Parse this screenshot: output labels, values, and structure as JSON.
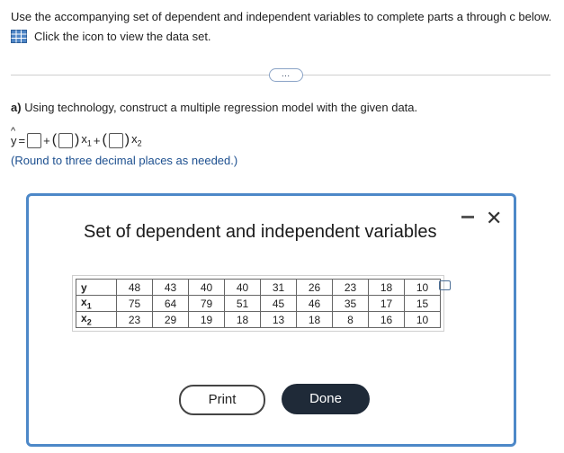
{
  "instructions": "Use the accompanying set of dependent and independent variables to complete parts a through c below.",
  "dataset_link": "Click the icon to view the data set.",
  "more_button": "…",
  "part_a": {
    "label": "a)",
    "prompt": "Using technology, construct a multiple regression model with the given data.",
    "round_note": "(Round to three decimal places as needed.)",
    "equation": {
      "lhs": "y",
      "eq": "=",
      "plus": "+",
      "x1": "x",
      "x1_sub": "1",
      "x2": "x",
      "x2_sub": "2"
    }
  },
  "modal": {
    "title": "Set of dependent and independent variables",
    "minimize_icon": "minimize-icon",
    "close_icon": "✕",
    "table": {
      "rows": [
        {
          "label": "y",
          "sub": "",
          "values": [
            "48",
            "43",
            "40",
            "40",
            "31",
            "26",
            "23",
            "18",
            "10"
          ]
        },
        {
          "label": "x",
          "sub": "1",
          "values": [
            "75",
            "64",
            "79",
            "51",
            "45",
            "46",
            "35",
            "17",
            "15"
          ]
        },
        {
          "label": "x",
          "sub": "2",
          "values": [
            "23",
            "29",
            "19",
            "18",
            "13",
            "18",
            "8",
            "16",
            "10"
          ]
        }
      ]
    },
    "print_label": "Print",
    "done_label": "Done"
  },
  "colors": {
    "modal_border": "#4d88c8",
    "done_bg": "#1f2a38",
    "note_text": "#1c4f8f"
  }
}
